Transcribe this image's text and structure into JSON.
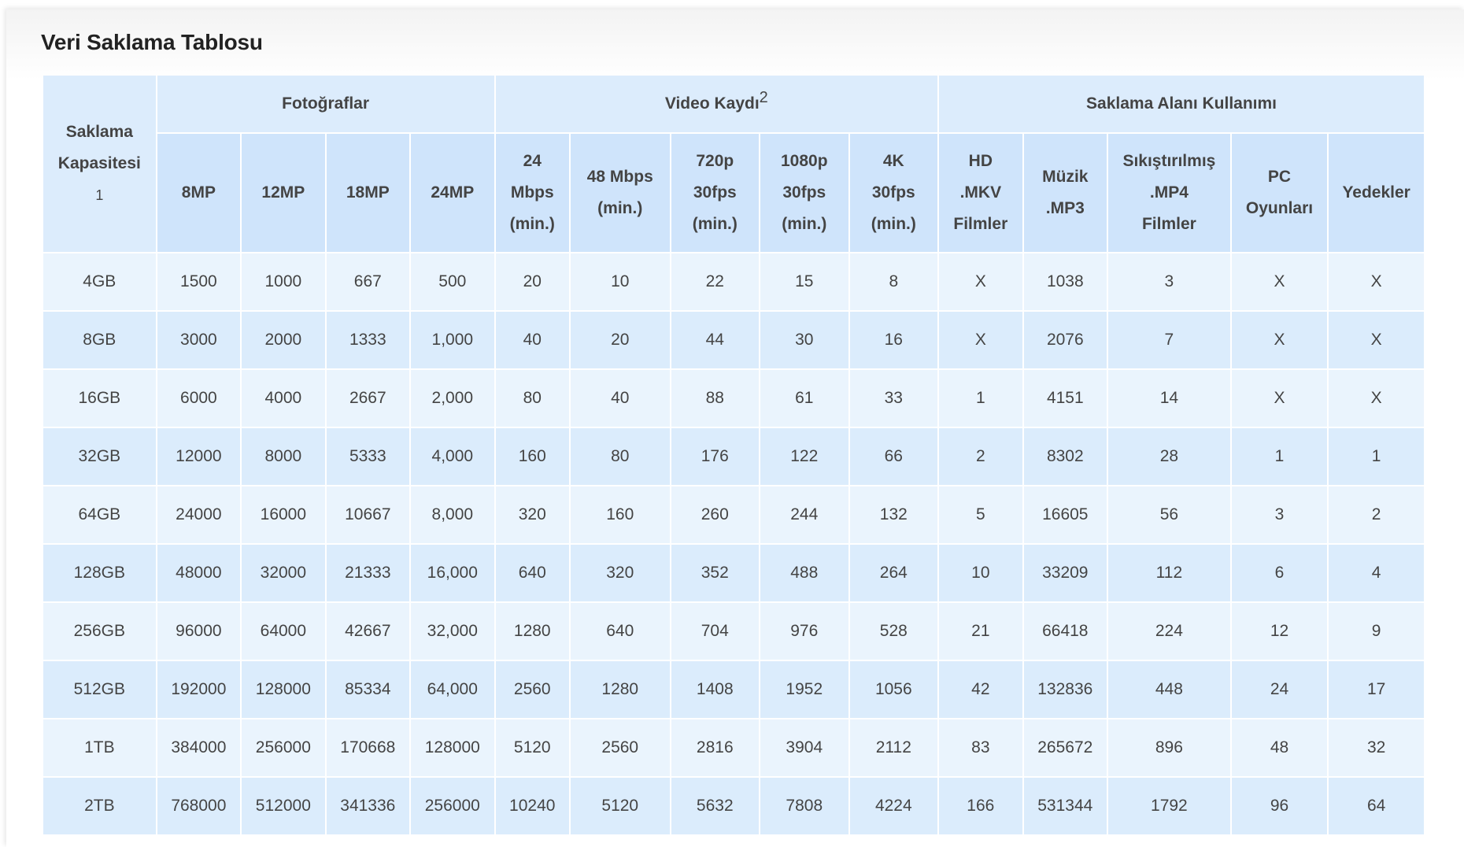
{
  "title": "Veri Saklama Tablosu",
  "header": {
    "capacity_label_line1": "Saklama",
    "capacity_label_line2": "Kapasitesi",
    "capacity_footnote": "1",
    "groups": {
      "photos": "Fotoğraflar",
      "video": "Video Kaydı",
      "video_footnote": "2",
      "usage": "Saklama Alanı Kullanımı"
    },
    "columns": [
      {
        "line1": "8MP"
      },
      {
        "line1": "12MP"
      },
      {
        "line1": "18MP"
      },
      {
        "line1": "24MP"
      },
      {
        "line1": "24",
        "line2": "Mbps",
        "line3": "(min.)"
      },
      {
        "line1": "48 Mbps",
        "line2": "(min.)"
      },
      {
        "line1": "720p",
        "line2": "30fps",
        "line3": "(min.)"
      },
      {
        "line1": "1080p",
        "line2": "30fps",
        "line3": "(min.)"
      },
      {
        "line1": "4K",
        "line2": "30fps",
        "line3": "(min.)"
      },
      {
        "line1": "HD",
        "line2": ".MKV",
        "line3": "Filmler"
      },
      {
        "line1": "Müzik",
        "line2": ".MP3"
      },
      {
        "line1": "Sıkıştırılmış",
        "line2": ".MP4",
        "line3": "Filmler"
      },
      {
        "line1": "PC",
        "line2": "Oyunları"
      },
      {
        "line1": "Yedekler"
      }
    ]
  },
  "rows": [
    [
      "4GB",
      "1500",
      "1000",
      "667",
      "500",
      "20",
      "10",
      "22",
      "15",
      "8",
      "X",
      "1038",
      "3",
      "X",
      "X"
    ],
    [
      "8GB",
      "3000",
      "2000",
      "1333",
      "1,000",
      "40",
      "20",
      "44",
      "30",
      "16",
      "X",
      "2076",
      "7",
      "X",
      "X"
    ],
    [
      "16GB",
      "6000",
      "4000",
      "2667",
      "2,000",
      "80",
      "40",
      "88",
      "61",
      "33",
      "1",
      "4151",
      "14",
      "X",
      "X"
    ],
    [
      "32GB",
      "12000",
      "8000",
      "5333",
      "4,000",
      "160",
      "80",
      "176",
      "122",
      "66",
      "2",
      "8302",
      "28",
      "1",
      "1"
    ],
    [
      "64GB",
      "24000",
      "16000",
      "10667",
      "8,000",
      "320",
      "160",
      "260",
      "244",
      "132",
      "5",
      "16605",
      "56",
      "3",
      "2"
    ],
    [
      "128GB",
      "48000",
      "32000",
      "21333",
      "16,000",
      "640",
      "320",
      "352",
      "488",
      "264",
      "10",
      "33209",
      "112",
      "6",
      "4"
    ],
    [
      "256GB",
      "96000",
      "64000",
      "42667",
      "32,000",
      "1280",
      "640",
      "704",
      "976",
      "528",
      "21",
      "66418",
      "224",
      "12",
      "9"
    ],
    [
      "512GB",
      "192000",
      "128000",
      "85334",
      "64,000",
      "2560",
      "1280",
      "1408",
      "1952",
      "1056",
      "42",
      "132836",
      "448",
      "24",
      "17"
    ],
    [
      "1TB",
      "384000",
      "256000",
      "170668",
      "128000",
      "5120",
      "2560",
      "2816",
      "3904",
      "2112",
      "83",
      "265672",
      "896",
      "48",
      "32"
    ],
    [
      "2TB",
      "768000",
      "512000",
      "341336",
      "256000",
      "10240",
      "5120",
      "5632",
      "7808",
      "4224",
      "166",
      "531344",
      "1792",
      "96",
      "64"
    ]
  ]
}
